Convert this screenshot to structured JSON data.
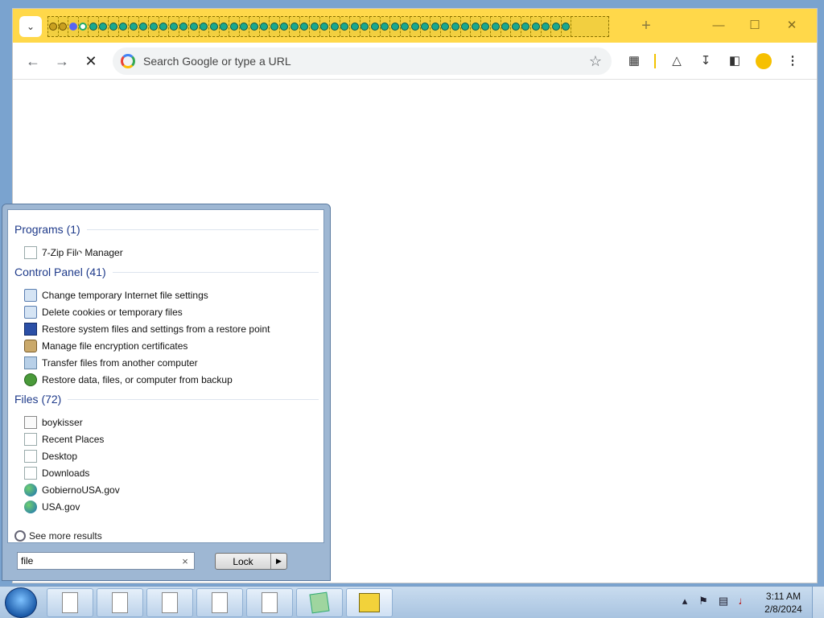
{
  "browser": {
    "tab_search_icon": "chevron-down-icon",
    "new_tab_label": "+",
    "window_controls": {
      "minimize": "—",
      "maximize": "☐",
      "close": "✕"
    },
    "nav": {
      "back": "←",
      "forward": "→",
      "stop": "✕"
    },
    "omnibox_placeholder": "Search Google or type a URL",
    "accent_color": "#ffd84a"
  },
  "start_menu": {
    "sections": [
      {
        "title": "Programs (1)",
        "items": [
          {
            "label": "7-Zip File Manager",
            "icon": "document-icon"
          }
        ]
      },
      {
        "title": "Control Panel (41)",
        "items": [
          {
            "label": "Change temporary Internet file settings",
            "icon": "internet-options-icon"
          },
          {
            "label": "Delete cookies or temporary files",
            "icon": "internet-options-icon"
          },
          {
            "label": "Restore system files and settings from a restore point",
            "icon": "system-restore-icon"
          },
          {
            "label": "Manage file encryption certificates",
            "icon": "certificate-icon"
          },
          {
            "label": "Transfer files from another computer",
            "icon": "transfer-icon"
          },
          {
            "label": "Restore data, files, or computer from backup",
            "icon": "backup-icon"
          }
        ]
      },
      {
        "title": "Files (72)",
        "items": [
          {
            "label": "boykisser",
            "icon": "text-file-icon"
          },
          {
            "label": "Recent Places",
            "icon": "document-icon"
          },
          {
            "label": "Desktop",
            "icon": "document-icon"
          },
          {
            "label": "Downloads",
            "icon": "document-icon"
          },
          {
            "label": "GobiernoUSA.gov",
            "icon": "globe-icon"
          },
          {
            "label": "USA.gov",
            "icon": "globe-icon"
          }
        ]
      }
    ],
    "see_more": "See more results",
    "search_value": "file",
    "lock_label": "Lock"
  },
  "taskbar": {
    "clock_time": "3:11 AM",
    "clock_date": "2/8/2024"
  }
}
